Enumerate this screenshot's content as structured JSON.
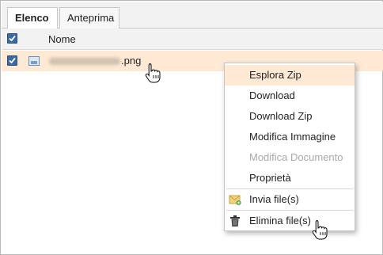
{
  "tabs": [
    {
      "label": "Elenco",
      "active": true
    },
    {
      "label": "Anteprima",
      "active": false
    }
  ],
  "table": {
    "header_checked": true,
    "column_name": "Nome"
  },
  "file": {
    "checked": true,
    "extension": ".png"
  },
  "context_menu": {
    "items": [
      {
        "label": "Esplora Zip",
        "highlighted": true,
        "enabled": true
      },
      {
        "label": "Download",
        "enabled": true
      },
      {
        "label": "Download Zip",
        "enabled": true
      },
      {
        "label": "Modifica Immagine",
        "enabled": true
      },
      {
        "label": "Modifica Documento",
        "enabled": false
      },
      {
        "label": "Proprietà",
        "enabled": true
      },
      {
        "label": "Invia file(s)",
        "icon": "send-file-icon",
        "enabled": true
      },
      {
        "label": "Elimina file(s)",
        "icon": "trash-icon",
        "enabled": true
      }
    ]
  },
  "colors": {
    "highlight": "#fde9d4",
    "disabled_text": "#a9a9a9",
    "checkbox": "#3a6aa5"
  }
}
